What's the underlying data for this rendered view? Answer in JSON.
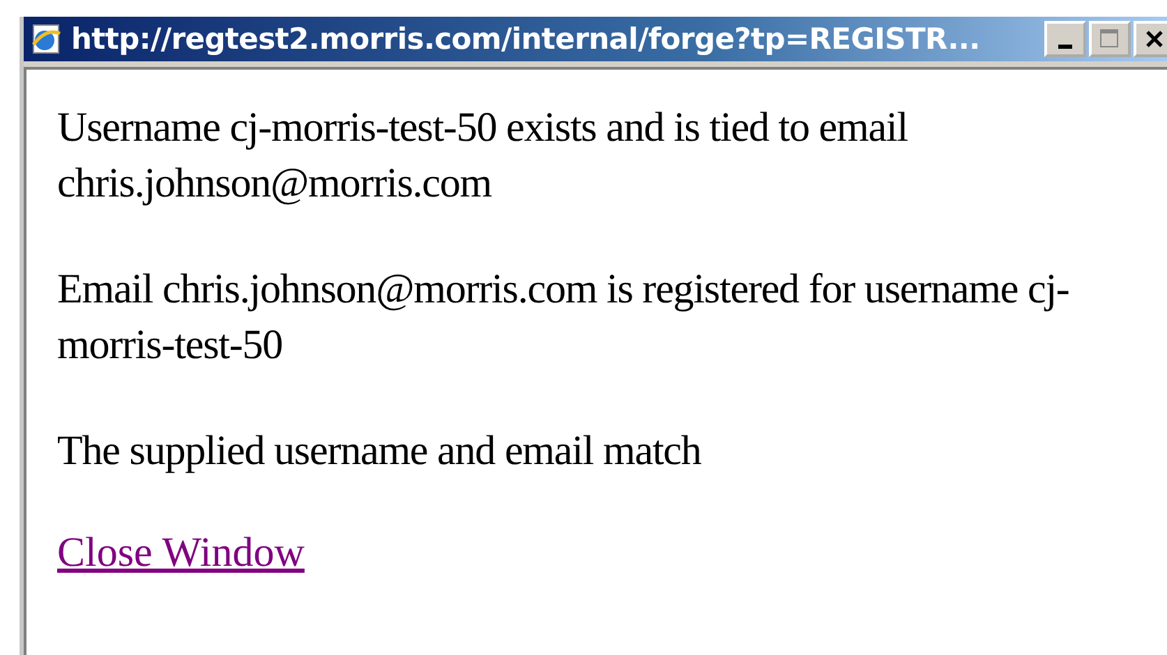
{
  "window": {
    "title": "http://regtest2.morris.com/internal/forge?tp=REGISTR..."
  },
  "paragraphs": [
    "Username cj-morris-test-50 exists and is tied to email chris.johnson@morris.com",
    "Email chris.johnson@morris.com is registered for username cj-morris-test-50",
    "The supplied username and email match"
  ],
  "link": {
    "label": "Close Window"
  }
}
